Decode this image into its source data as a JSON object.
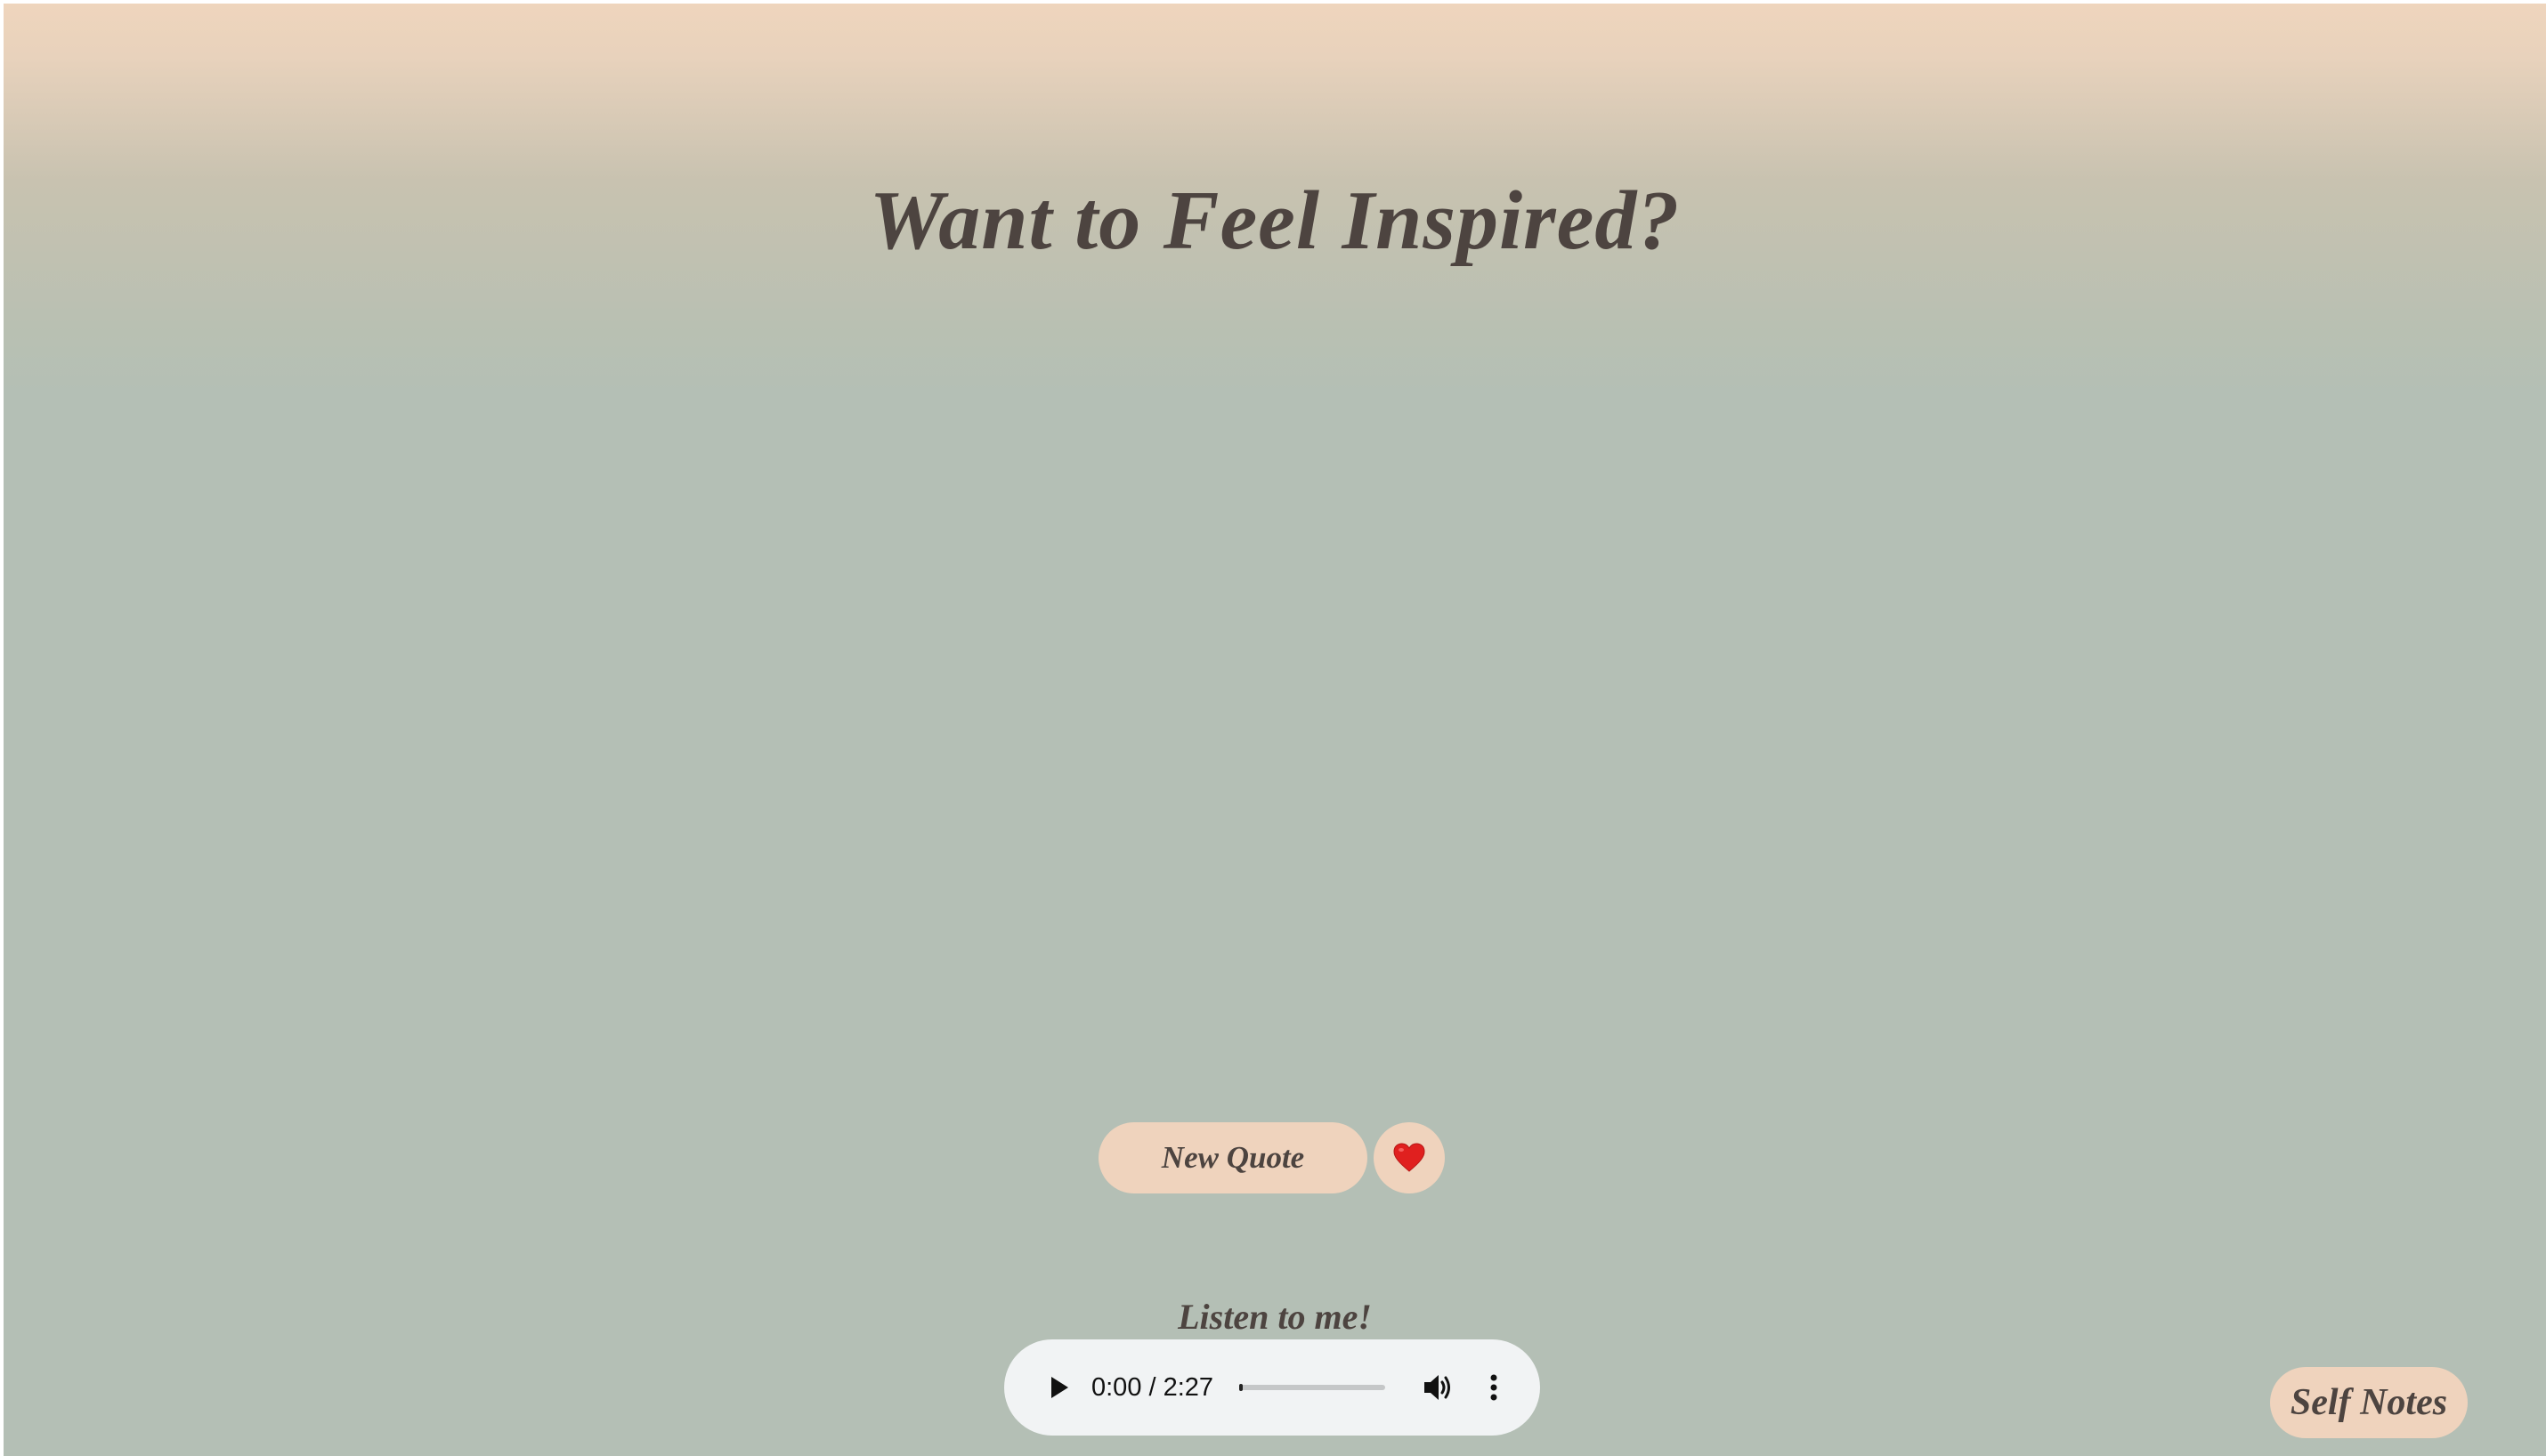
{
  "header": {
    "title": "Want to Feel Inspired?"
  },
  "actions": {
    "new_quote_label": "New Quote",
    "heart_icon": "heart-icon"
  },
  "audio": {
    "label": "Listen to me!",
    "time_display": "0:00 / 2:27",
    "current_time": "0:00",
    "duration": "2:27",
    "progress": 0
  },
  "footer": {
    "self_notes_label": "Self Notes"
  },
  "colors": {
    "top_gradient": "#efd5bd",
    "background": "#b4bfb5",
    "button": "#efd3bd",
    "text": "#4d4440",
    "player": "#f1f3f4",
    "heart": "#e0201f"
  }
}
